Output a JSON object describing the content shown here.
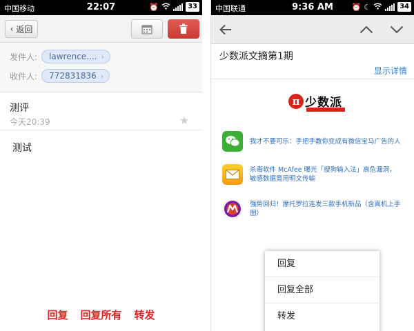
{
  "left": {
    "status": {
      "carrier": "中国移动",
      "time": "22:07",
      "battery": "33"
    },
    "toolbar": {
      "back_label": "返回"
    },
    "from": {
      "label": "发件人:",
      "value": "lawrence...."
    },
    "to": {
      "label": "收件人:",
      "value": "772831836"
    },
    "subject": "测评",
    "datetime": "今天20:39",
    "body": "测试",
    "actions": {
      "reply": "回复",
      "reply_all": "回复所有",
      "forward": "转发"
    }
  },
  "right": {
    "status": {
      "carrier": "中国联通",
      "time": "9:36 AM",
      "battery": "34"
    },
    "title": "少数派文摘第1期",
    "show_details": "显示详情",
    "logo_text": "少数派",
    "items": [
      {
        "icon": "wechat-icon",
        "text": "我才不要可乐：手把手教你变成有微信宝马广告的人"
      },
      {
        "icon": "mail-icon",
        "text": "杀毒软件 McAfee 曝光「搜狗输入法」高危漏洞，敏感数据竟用明文传输"
      },
      {
        "icon": "motorola-icon",
        "text": "强势回归！摩托罗拉连发三款手机新品（含真机上手图）"
      }
    ],
    "menu": {
      "reply": "回复",
      "reply_all": "回复全部",
      "forward": "转发"
    }
  },
  "colors": {
    "accent_red": "#e62222",
    "link_blue": "#2f7fd0",
    "chip_bg": "#dfe9f7"
  }
}
